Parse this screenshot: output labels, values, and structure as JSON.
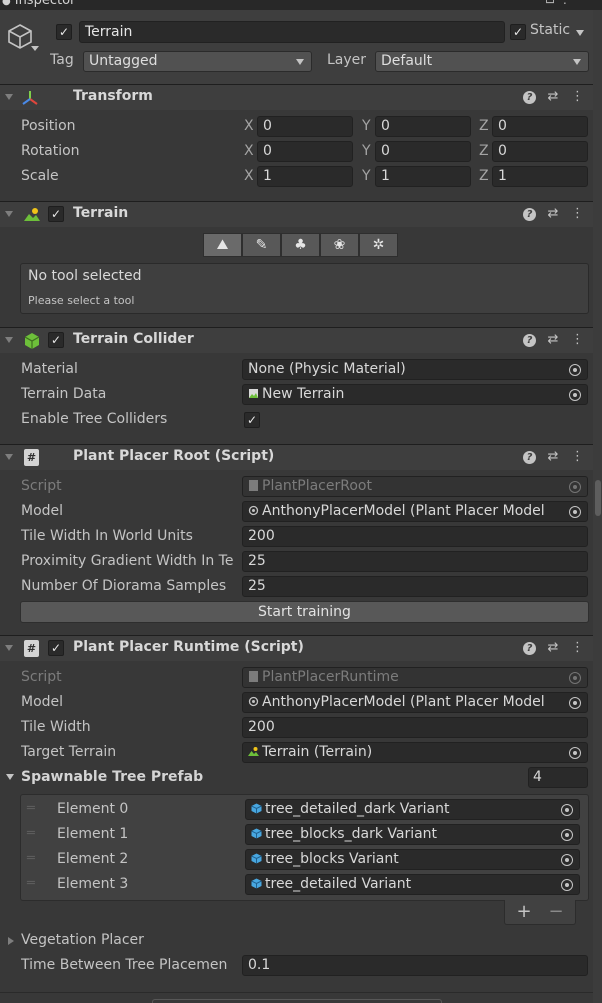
{
  "window": {
    "tab_label": "Inspector"
  },
  "gameobject": {
    "active": true,
    "name": "Terrain",
    "static_label": "Static",
    "static_checked": true,
    "tag_label": "Tag",
    "tag_value": "Untagged",
    "layer_label": "Layer",
    "layer_value": "Default"
  },
  "transform": {
    "title": "Transform",
    "rows": [
      {
        "label": "Position",
        "x": "0",
        "y": "0",
        "z": "0"
      },
      {
        "label": "Rotation",
        "x": "0",
        "y": "0",
        "z": "0"
      },
      {
        "label": "Scale",
        "x": "1",
        "y": "1",
        "z": "1"
      }
    ],
    "axes": {
      "x": "X",
      "y": "Y",
      "z": "Z"
    }
  },
  "terrain": {
    "title": "Terrain",
    "enabled": true,
    "tools": [
      "raise-lower-terrain-icon",
      "paint-brush-icon",
      "paint-trees-icon",
      "paint-details-icon",
      "settings-gear-icon"
    ],
    "info_title": "No tool selected",
    "info_sub": "Please select a tool"
  },
  "collider": {
    "title": "Terrain Collider",
    "enabled": true,
    "material_label": "Material",
    "material_value": "None (Physic Material)",
    "terrain_data_label": "Terrain Data",
    "terrain_data_value": "New Terrain",
    "tree_colliders_label": "Enable Tree Colliders",
    "tree_colliders_checked": true
  },
  "root_script": {
    "title": "Plant Placer Root (Script)",
    "script_label": "Script",
    "script_value": "PlantPlacerRoot",
    "model_label": "Model",
    "model_value": "AnthonyPlacerModel (Plant Placer Model",
    "tile_width_label": "Tile Width In World Units",
    "tile_width_value": "200",
    "proximity_label": "Proximity Gradient Width In Te",
    "proximity_value": "25",
    "samples_label": "Number Of Diorama Samples",
    "samples_value": "25",
    "button_label": "Start training"
  },
  "runtime_script": {
    "title": "Plant Placer Runtime (Script)",
    "enabled": true,
    "script_label": "Script",
    "script_value": "PlantPlacerRuntime",
    "model_label": "Model",
    "model_value": "AnthonyPlacerModel (Plant Placer Model",
    "tile_width_label": "Tile Width",
    "tile_width_value": "200",
    "target_label": "Target Terrain",
    "target_value": "Terrain (Terrain)",
    "prefab_label": "Spawnable Tree Prefab",
    "prefab_count": "4",
    "elements": [
      {
        "label": "Element 0",
        "value": "tree_detailed_dark Variant"
      },
      {
        "label": "Element 1",
        "value": "tree_blocks_dark Variant"
      },
      {
        "label": "Element 2",
        "value": "tree_blocks Variant"
      },
      {
        "label": "Element 3",
        "value": "tree_detailed Variant"
      }
    ],
    "add_symbol": "+",
    "remove_symbol": "−",
    "veg_label": "Vegetation Placer",
    "time_label": "Time Between Tree Placemen",
    "time_value": "0.1"
  },
  "colors": {
    "panel_bg": "#383838",
    "header_bg": "#3e3e3e",
    "field_bg": "#2a2a2a",
    "text": "#c4c4c4"
  }
}
